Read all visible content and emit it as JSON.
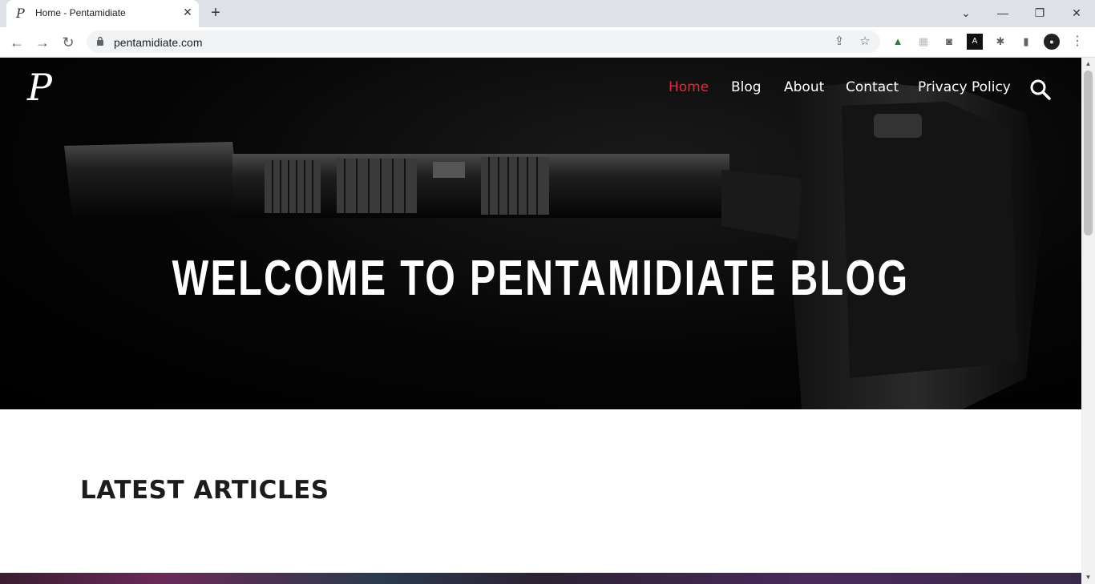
{
  "browser": {
    "tab": {
      "title": "Home - Pentamidiate",
      "favicon": "P"
    },
    "url": "pentamidiate.com",
    "icons": {
      "back": "back-arrow-icon",
      "forward": "forward-arrow-icon",
      "reload": "reload-icon",
      "share": "share-icon",
      "bookmark": "star-icon",
      "extensions": "puzzle-icon",
      "sidepanel": "side-panel-icon",
      "menu": "kebab-menu-icon"
    }
  },
  "site": {
    "logo_text": "P",
    "nav": [
      {
        "label": "Home",
        "active": true
      },
      {
        "label": "Blog",
        "active": false
      },
      {
        "label": "About",
        "active": false
      },
      {
        "label": "Contact",
        "active": false
      },
      {
        "label": "Privacy Policy",
        "active": false
      }
    ],
    "hero_title": "WELCOME TO PENTAMIDIATE BLOG",
    "section_title": "LATEST ARTICLES",
    "accent_color": "#e8253b"
  }
}
